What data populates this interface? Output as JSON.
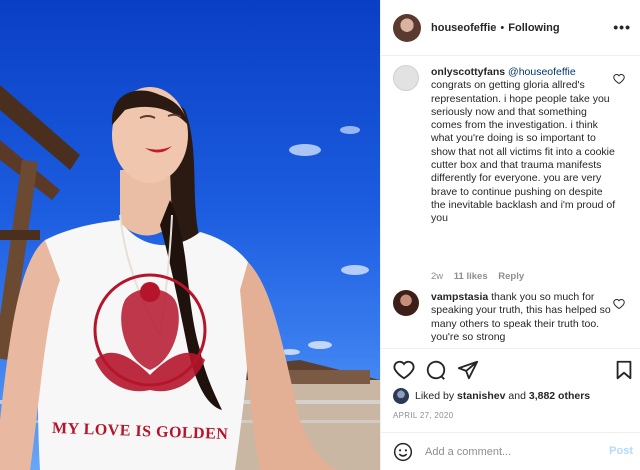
{
  "post": {
    "photo": {
      "shirt_text": "MY LOVE IS GOLDEN"
    },
    "header": {
      "username": "houseofeffie",
      "separator": "•",
      "follow_status": "Following",
      "more_icon": "more-horizontal-icon"
    },
    "comments": [
      {
        "author": "onlyscottyfans",
        "mention": "@houseofeffie",
        "text": "congrats on getting gloria allred's representation. i hope people take you seriously now and that something comes from the investigation. i think what you're doing is so important to show that not all victims fit into a cookie cutter box and that trauma manifests differently for everyone. you are very brave to continue pushing on despite the inevitable backlash and i'm proud of you",
        "age": "2w",
        "likes": "11 likes",
        "reply": "Reply"
      },
      {
        "author": "vampstasia",
        "text": "thank you so much for speaking your truth, this has helped so many others to speak their truth too. you're so strong"
      }
    ],
    "actions": {
      "like_icon": "heart-icon",
      "comment_icon": "comment-icon",
      "share_icon": "share-icon",
      "save_icon": "bookmark-icon"
    },
    "likes": {
      "prefix": "Liked by",
      "user": "stanishev",
      "conjunction": "and",
      "others": "3,882 others"
    },
    "date": "APRIL 27, 2020",
    "add_comment": {
      "placeholder": "Add a comment...",
      "post_label": "Post",
      "emoji_icon": "emoji-icon"
    },
    "colors": {
      "link": "#00376b",
      "muted": "#8e8e8e",
      "post_disabled": "#b3dbff",
      "sky": "#1c5de0",
      "shirt_print": "#b5152b"
    }
  }
}
